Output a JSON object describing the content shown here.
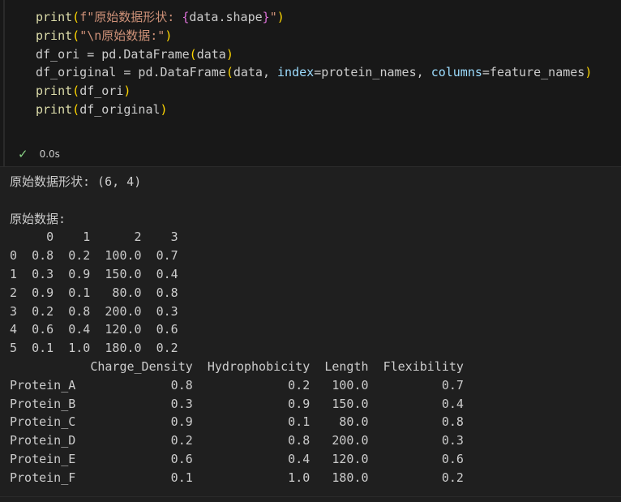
{
  "code_cell": {
    "lines": [
      [
        {
          "t": "print",
          "c": "fn"
        },
        {
          "t": "(",
          "c": "par"
        },
        {
          "t": "f\"原始数据形状: ",
          "c": "str"
        },
        {
          "t": "{",
          "c": "brc"
        },
        {
          "t": "data.shape",
          "c": "var"
        },
        {
          "t": "}",
          "c": "brc"
        },
        {
          "t": "\"",
          "c": "str"
        },
        {
          "t": ")",
          "c": "par"
        }
      ],
      [
        {
          "t": "print",
          "c": "fn"
        },
        {
          "t": "(",
          "c": "par"
        },
        {
          "t": "\"\\n原始数据:\"",
          "c": "str"
        },
        {
          "t": ")",
          "c": "par"
        }
      ],
      [
        {
          "t": "df_ori = pd.",
          "c": "var"
        },
        {
          "t": "DataFrame",
          "c": "var"
        },
        {
          "t": "(",
          "c": "par"
        },
        {
          "t": "data",
          "c": "var"
        },
        {
          "t": ")",
          "c": "par"
        }
      ],
      [
        {
          "t": "df_original = pd.",
          "c": "var"
        },
        {
          "t": "DataFrame",
          "c": "var"
        },
        {
          "t": "(",
          "c": "par"
        },
        {
          "t": "data, ",
          "c": "var"
        },
        {
          "t": "index",
          "c": "prm"
        },
        {
          "t": "=protein_names, ",
          "c": "var"
        },
        {
          "t": "columns",
          "c": "prm"
        },
        {
          "t": "=feature_names",
          "c": "var"
        },
        {
          "t": ")",
          "c": "par"
        }
      ],
      [
        {
          "t": "print",
          "c": "fn"
        },
        {
          "t": "(",
          "c": "par"
        },
        {
          "t": "df_ori",
          "c": "var"
        },
        {
          "t": ")",
          "c": "par"
        }
      ],
      [
        {
          "t": "print",
          "c": "fn"
        },
        {
          "t": "(",
          "c": "par"
        },
        {
          "t": "df_original",
          "c": "var"
        },
        {
          "t": ")",
          "c": "par"
        }
      ]
    ]
  },
  "status": {
    "check_icon": "✓",
    "duration": "0.0s"
  },
  "output": {
    "lines": [
      "原始数据形状: (6, 4)",
      "",
      "原始数据:",
      "     0    1      2    3",
      "0  0.8  0.2  100.0  0.7",
      "1  0.3  0.9  150.0  0.4",
      "2  0.9  0.1   80.0  0.8",
      "3  0.2  0.8  200.0  0.3",
      "4  0.6  0.4  120.0  0.6",
      "5  0.1  1.0  180.0  0.2",
      "           Charge_Density  Hydrophobicity  Length  Flexibility",
      "Protein_A             0.8             0.2   100.0          0.7",
      "Protein_B             0.3             0.9   150.0          0.4",
      "Protein_C             0.9             0.1    80.0          0.8",
      "Protein_D             0.2             0.8   200.0          0.3",
      "Protein_E             0.6             0.4   120.0          0.6",
      "Protein_F             0.1             1.0   180.0          0.2"
    ]
  }
}
